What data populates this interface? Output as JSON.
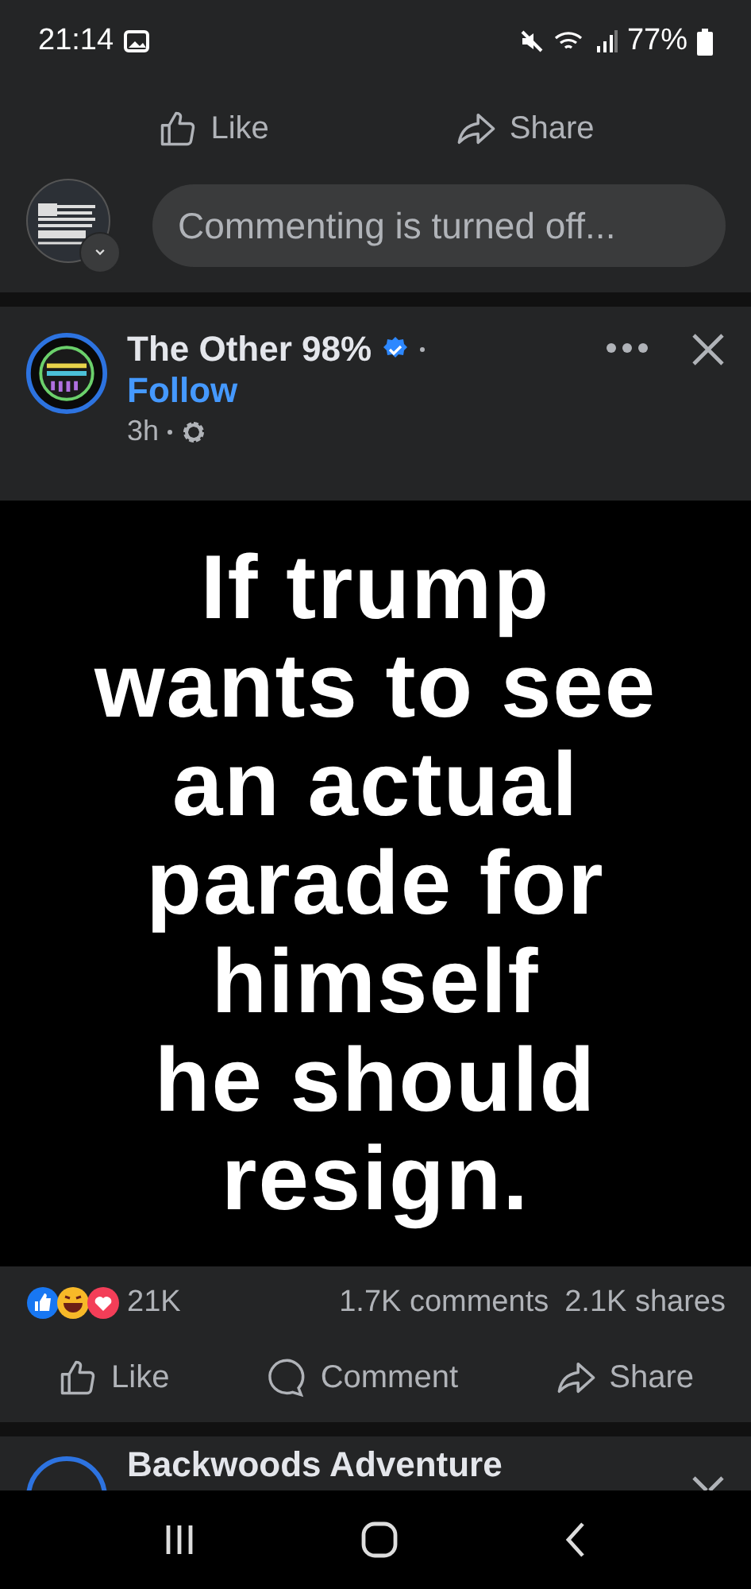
{
  "status_bar": {
    "time": "21:14",
    "battery": "77%"
  },
  "previous_post": {
    "actions": [
      "Like",
      "Share"
    ],
    "comment_placeholder": "Commenting is turned off..."
  },
  "post": {
    "page_name": "The Other 98%",
    "verified": true,
    "follow": "Follow",
    "time": "3h",
    "image_text": "If trump\nwants to see\nan actual\nparade for\nhimself\nhe should\nresign.",
    "reactions_count": "21K",
    "comments_count": "1.7K comments",
    "shares_count": "2.1K shares",
    "actions": [
      {
        "kind": "like",
        "label": "Like"
      },
      {
        "kind": "comment",
        "label": "Comment"
      },
      {
        "kind": "share",
        "label": "Share"
      }
    ]
  },
  "next_post": {
    "page_name": "Backwoods Adventure"
  }
}
